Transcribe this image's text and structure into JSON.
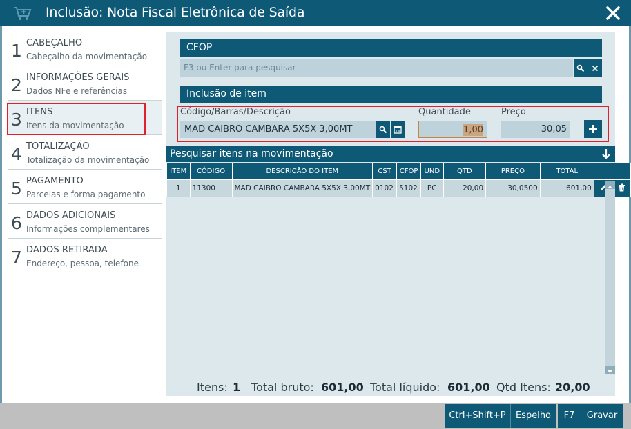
{
  "window": {
    "title": "Inclusão: Nota Fiscal Eletrônica de Saída"
  },
  "steps": [
    {
      "num": "1",
      "name": "CABEÇALHO",
      "desc": "Cabeçalho da movimentação"
    },
    {
      "num": "2",
      "name": "INFORMAÇÕES GERAIS",
      "desc": "Dados NFe e referências"
    },
    {
      "num": "3",
      "name": "ITENS",
      "desc": "Itens da movimentação"
    },
    {
      "num": "4",
      "name": "TOTALIZAÇÃO",
      "desc": "Totalização da movimentação"
    },
    {
      "num": "5",
      "name": "PAGAMENTO",
      "desc": "Parcelas e forma pagamento"
    },
    {
      "num": "6",
      "name": "DADOS ADICIONAIS",
      "desc": "Informações complementares"
    },
    {
      "num": "7",
      "name": "DADOS RETIRADA",
      "desc": "Endereço, pessoa, telefone"
    }
  ],
  "cfop": {
    "header": "CFOP",
    "placeholder": "F3 ou Enter para pesquisar"
  },
  "inclusao": {
    "header": "Inclusão de item",
    "codigo_label": "Código/Barras/Descrição",
    "codigo_value": "MAD CAIBRO CAMBARA 5X5X 3,00MT",
    "quantidade_label": "Quantidade",
    "quantidade_value": "1,00",
    "preco_label": "Preço",
    "preco_value": "30,05"
  },
  "search_bar": {
    "label": "Pesquisar itens na movimentação"
  },
  "table": {
    "headers": [
      "ITEM",
      "CÓDIGO",
      "DESCRIÇÃO DO ITEM",
      "CST",
      "CFOP",
      "UND",
      "QTD",
      "PREÇO",
      "TOTAL"
    ],
    "rows": [
      {
        "item": "1",
        "codigo": "11300",
        "descricao": "MAD CAIBRO CAMBARA 5X5X 3,00MT",
        "cst": "0102",
        "cfop": "5102",
        "und": "PC",
        "qtd": "20,00",
        "preco": "30,0500",
        "total": "601,00"
      }
    ]
  },
  "totals": {
    "itens_label": "Itens:",
    "itens_value": "1",
    "bruto_label": "Total bruto:",
    "bruto_value": "601,00",
    "liquido_label": "Total líquido:",
    "liquido_value": "601,00",
    "qtd_label": "Qtd Itens:",
    "qtd_value": "20,00"
  },
  "footer_buttons": {
    "ctrl_shift_p": "Ctrl+Shift+P",
    "espelho": "Espelho",
    "f7": "F7",
    "gravar": "Gravar"
  },
  "active_step": "3"
}
